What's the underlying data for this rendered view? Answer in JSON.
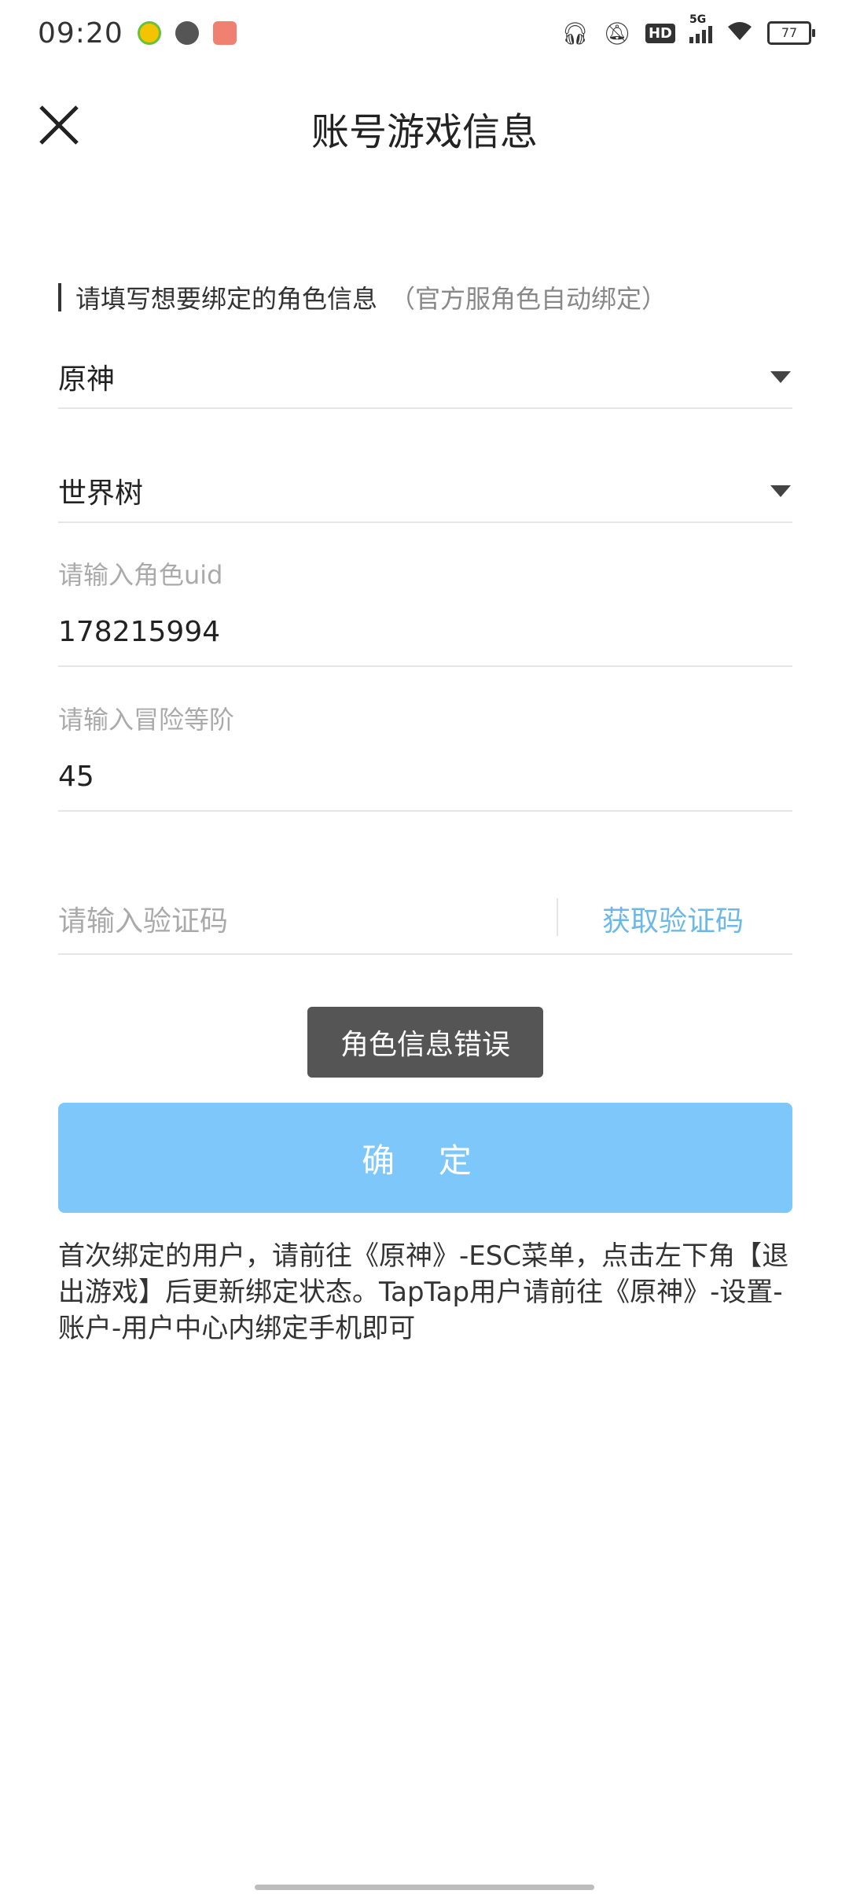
{
  "status_bar": {
    "time": "09:20",
    "network_label": "5G",
    "hd_label": "HD",
    "battery": "77"
  },
  "header": {
    "title": "账号游戏信息"
  },
  "form": {
    "hint_main": "请填写想要绑定的角色信息",
    "hint_sub": "（官方服角色自动绑定）",
    "game_select": {
      "value": "原神"
    },
    "server_select": {
      "value": "世界树"
    },
    "uid": {
      "label": "请输入角色uid",
      "value": "178215994"
    },
    "level": {
      "label": "请输入冒险等阶",
      "value": "45"
    },
    "code": {
      "placeholder": "请输入验证码",
      "get_code_label": "获取验证码"
    }
  },
  "toast": {
    "text": "角色信息错误"
  },
  "confirm": {
    "label": "确 定"
  },
  "note": {
    "text": "首次绑定的用户，请前往《原神》-ESC菜单，点击左下角【退出游戏】后更新绑定状态。TapTap用户请前往《原神》-设置-账户-用户中心内绑定手机即可"
  },
  "colors": {
    "accent_link": "#6cb8e6",
    "confirm_bg": "#7ec7fb",
    "toast_bg": "#555555"
  }
}
